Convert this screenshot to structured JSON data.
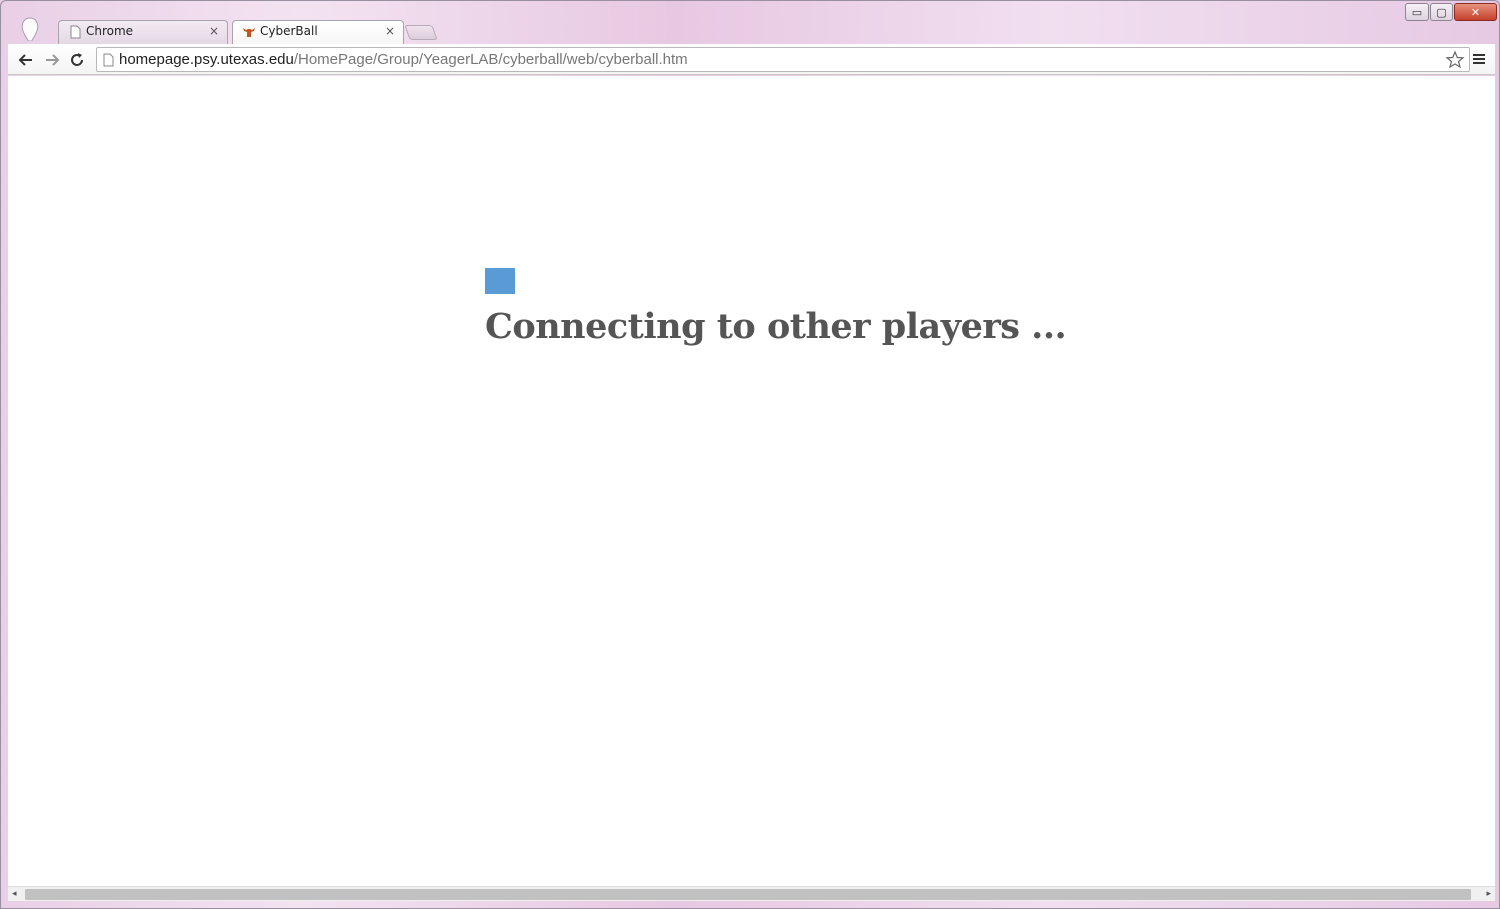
{
  "browser": {
    "tabs": [
      {
        "label": "Chrome",
        "active": false,
        "icon": "page-icon"
      },
      {
        "label": "CyberBall",
        "active": true,
        "icon": "longhorn-favicon-icon"
      }
    ],
    "tab_close_glyph": "×",
    "window_controls": {
      "minimize": "▭",
      "maximize": "▢",
      "close": "✕"
    },
    "address": {
      "host": "homepage.psy.utexas.edu",
      "path": "/HomePage/Group/YeagerLAB/cyberball/web/cyberball.htm"
    }
  },
  "page": {
    "status_text": "Connecting to other players ...",
    "loader_color": "#5b9bd5"
  },
  "colors": {
    "frame": "#e9cfe6",
    "text": "#555555"
  }
}
